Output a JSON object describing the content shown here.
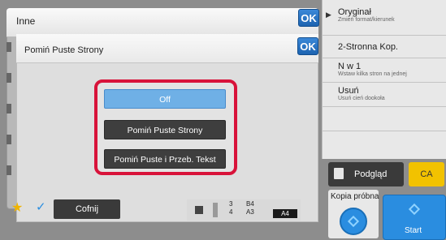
{
  "back_panel": {
    "title": "Inne",
    "ok_label": "OK"
  },
  "dialog": {
    "title": "Pomiń Puste Strony",
    "ok_label": "OK",
    "options": [
      {
        "label": "Off",
        "selected": true
      },
      {
        "label": "Pomiń Puste Strony",
        "selected": false
      },
      {
        "label": "Pomiń Puste i Przeb. Tekst",
        "selected": false
      }
    ]
  },
  "right_panel": {
    "items": [
      {
        "title": "Oryginał",
        "subtitle": "Zmień format/kierunek"
      },
      {
        "title": "2-Stronna Kop.",
        "subtitle": ""
      },
      {
        "title": "N w 1",
        "subtitle": "Wstaw kilka stron na jednej"
      },
      {
        "title": "Usuń",
        "subtitle": "Usuń cień dookoła"
      }
    ],
    "preview_label": "Podgląd",
    "ca_label": "CA",
    "kopia_label": "Kopia próbna",
    "start_label": "Start"
  },
  "bottom_bar": {
    "back_label": "Cofnij",
    "trays": [
      {
        "number": "3",
        "size": "B4"
      },
      {
        "number": "4",
        "size": "A3"
      }
    ],
    "active_size": "A4"
  },
  "colors": {
    "accent_blue": "#2a8de0",
    "highlight_red": "#d8133a",
    "ca_yellow": "#f2c200",
    "selected_option": "#6fb0e6"
  }
}
